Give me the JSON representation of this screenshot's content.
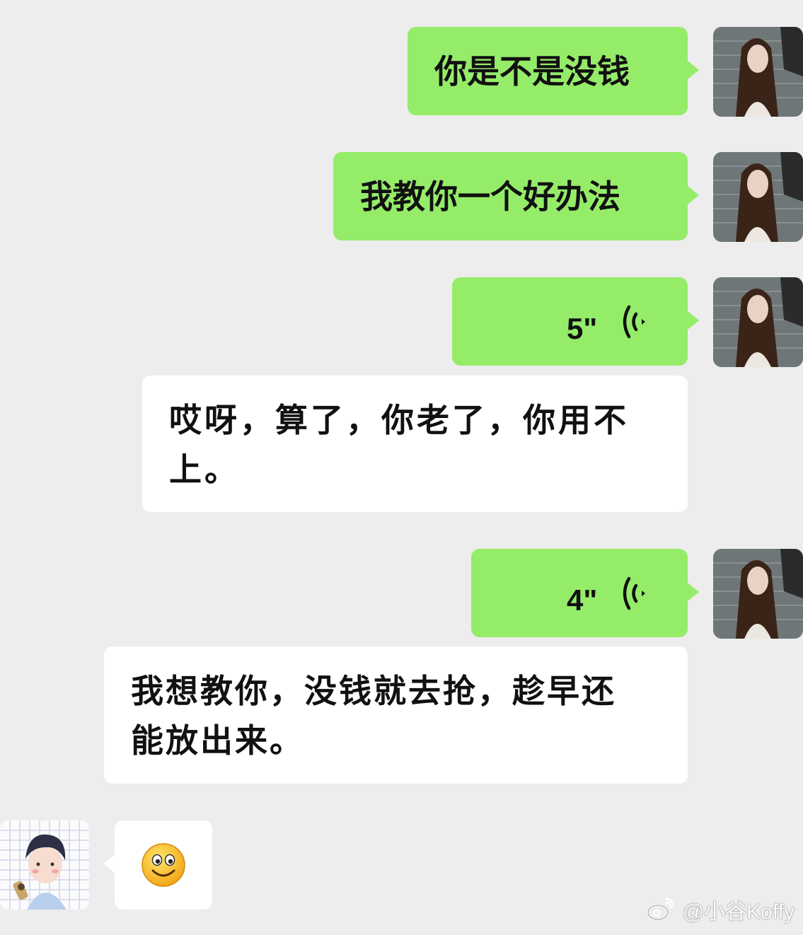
{
  "messages": [
    {
      "side": "right",
      "type": "text",
      "text": "你是不是没钱"
    },
    {
      "side": "right",
      "type": "text",
      "text": "我教你一个好办法"
    },
    {
      "side": "right",
      "type": "voice",
      "duration": "5\""
    },
    {
      "side": "right",
      "type": "text",
      "text": "哎呀，算了，你老了，你用不上。"
    },
    {
      "side": "right",
      "type": "voice",
      "duration": "4\""
    },
    {
      "side": "right",
      "type": "text",
      "text": "我想教你，没钱就去抢，趁早还能放出来。"
    },
    {
      "side": "left",
      "type": "emoji",
      "emoji": "slightly-smiling-face-emoji"
    }
  ],
  "m1": "你是不是没钱",
  "m2": "我教你一个好办法",
  "m3": "5\"",
  "m4a": "哎呀，算了，你老了，你用不",
  "m4b": "上。",
  "m5": "4\"",
  "m6a": "我想教你，没钱就去抢，趁早还",
  "m6b": "能放出来。",
  "watermark": "@小谷Koffy",
  "colors": {
    "background": "#ededed",
    "sent_bubble": "#95ec69",
    "received_bubble": "#ffffff"
  },
  "icons": {
    "voice": "voice-wave-icon",
    "weibo": "weibo-logo-icon"
  }
}
